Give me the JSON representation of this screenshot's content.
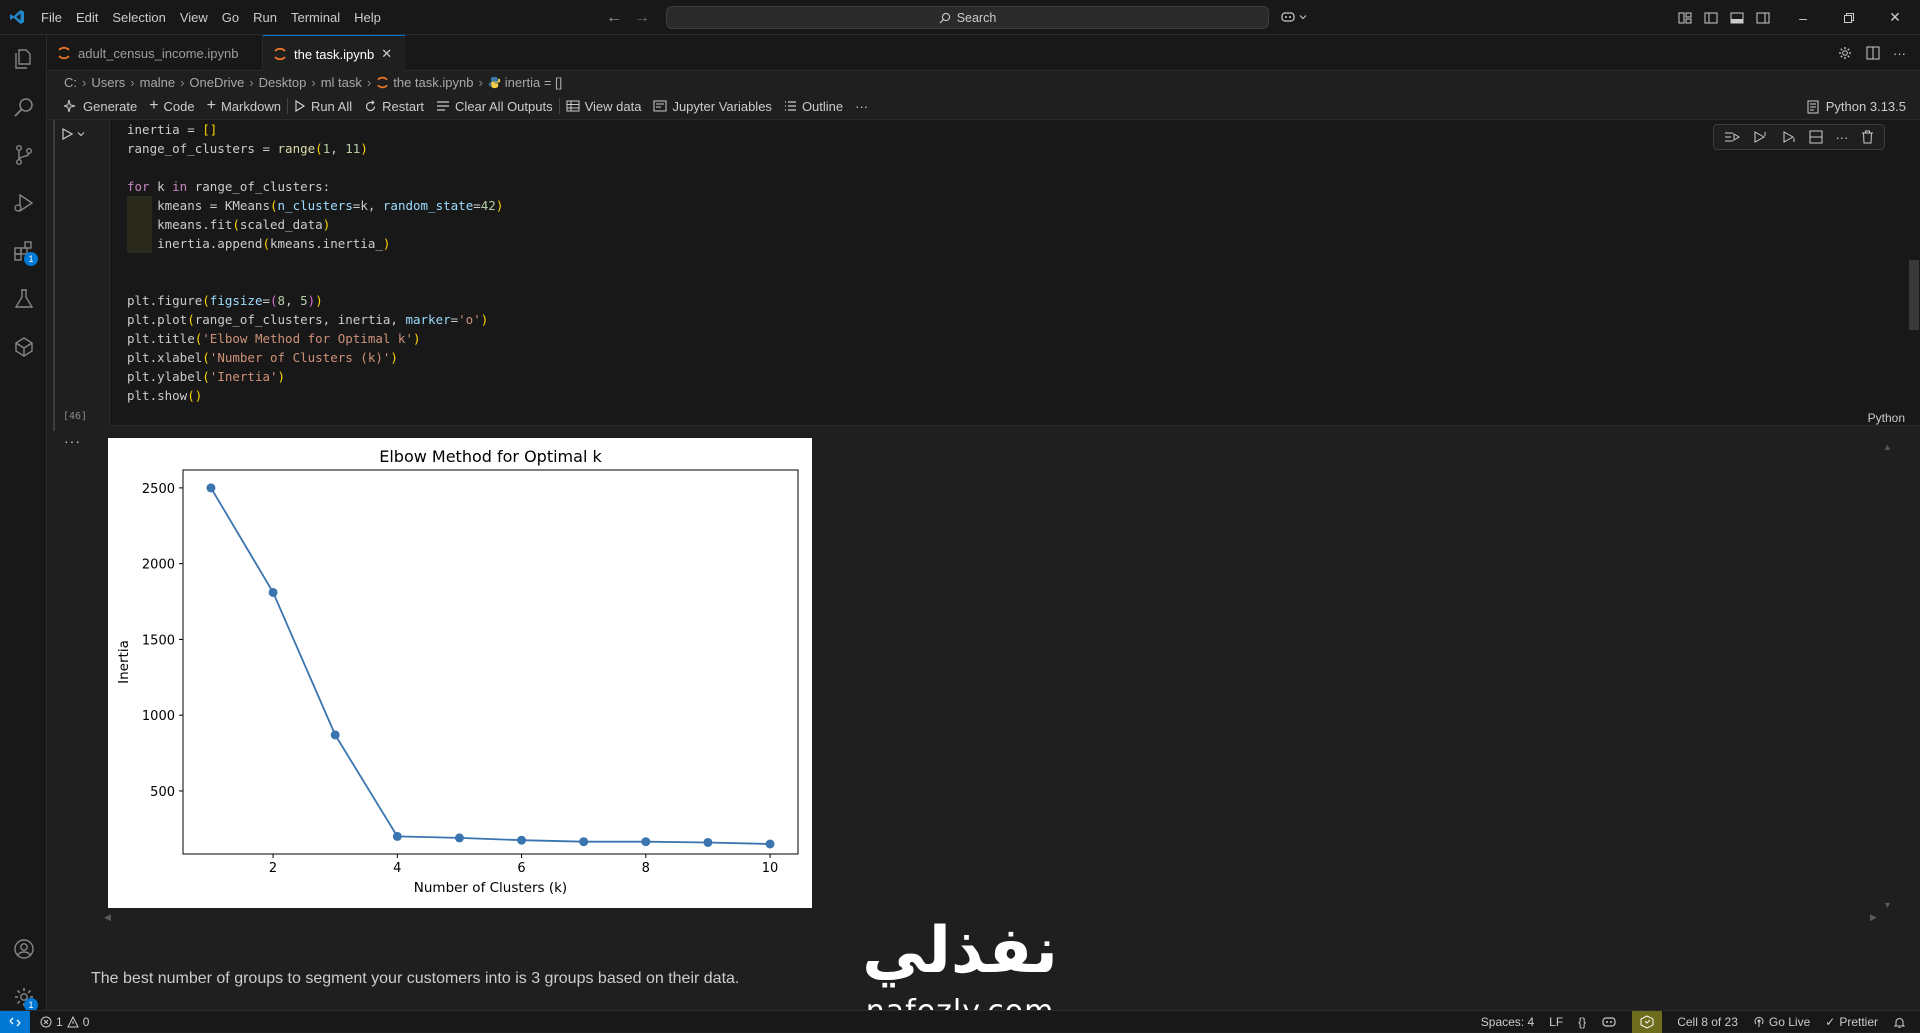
{
  "menu": [
    "File",
    "Edit",
    "Selection",
    "View",
    "Go",
    "Run",
    "Terminal",
    "Help"
  ],
  "search": {
    "placeholder": "Search"
  },
  "tabs": [
    {
      "label": "adult_census_income.ipynb",
      "active": false
    },
    {
      "label": "the task.ipynb",
      "active": true
    }
  ],
  "breadcrumb": [
    "C:",
    "Users",
    "malne",
    "OneDrive",
    "Desktop",
    "ml task",
    "the task.ipynb",
    "inertia = []"
  ],
  "toolbar": {
    "generate": "Generate",
    "code": "Code",
    "markdown": "Markdown",
    "run_all": "Run All",
    "restart": "Restart",
    "clear_outputs": "Clear All Outputs",
    "view_data": "View data",
    "jupyter_vars": "Jupyter Variables",
    "outline": "Outline",
    "more": "···",
    "kernel": "Python 3.13.5"
  },
  "cell": {
    "exec_count": "[46]",
    "language": "Python",
    "output_ellipsis": "···"
  },
  "activity_badges": {
    "extensions": "1",
    "settings": "1"
  },
  "chart_data": {
    "type": "line",
    "title": "Elbow Method for Optimal k",
    "xlabel": "Number of Clusters (k)",
    "ylabel": "Inertia",
    "x": [
      1,
      2,
      3,
      4,
      5,
      6,
      7,
      8,
      9,
      10
    ],
    "y": [
      2500,
      1810,
      870,
      200,
      190,
      175,
      165,
      165,
      160,
      150
    ],
    "xlim": [
      0.55,
      10.45
    ],
    "ylim": [
      84,
      2618
    ],
    "xticks": [
      2,
      4,
      6,
      8,
      10
    ],
    "yticks": [
      500,
      1000,
      1500,
      2000,
      2500
    ],
    "grid": false,
    "color": "#3b75af",
    "marker": "o"
  },
  "markdown_text": "The best number of groups to segment your customers into is 3 groups based on their data.",
  "watermark": {
    "arabic": "نفذلي",
    "latin": "nafezly.com"
  },
  "status": {
    "errors": "1",
    "warnings": "0",
    "spaces": "Spaces: 4",
    "eol": "LF",
    "braces": "{}",
    "cell_pos": "Cell 8 of 23",
    "go_live": "Go Live",
    "prettier": "Prettier"
  },
  "colors": {
    "accent": "#0078d4",
    "line": "#3b75af",
    "bg": "#1f1f1f"
  }
}
